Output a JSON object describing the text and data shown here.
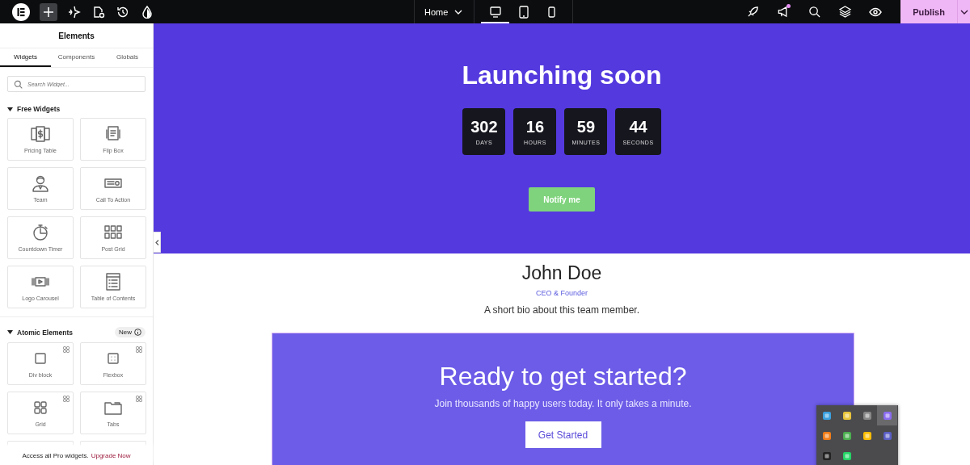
{
  "top_bar": {
    "page_selector": "Home",
    "devices": [
      {
        "kind": "desktop",
        "selected": true
      },
      {
        "kind": "tablet",
        "selected": false
      },
      {
        "kind": "mobile",
        "selected": false
      }
    ],
    "notification_dot": true,
    "publish": "Publish"
  },
  "sidebar": {
    "title": "Elements",
    "tabs": [
      {
        "label": "Widgets",
        "selected": true
      },
      {
        "label": "Components",
        "selected": false
      },
      {
        "label": "Globals",
        "selected": false
      }
    ],
    "search": {
      "placeholder": "Search Widget..."
    },
    "sections": [
      {
        "title": "Free Widgets",
        "expanded": true,
        "widgets": [
          {
            "label": "Pricing Table",
            "pro": false
          },
          {
            "label": "Flip Box",
            "pro": false
          },
          {
            "label": "Team",
            "pro": false
          },
          {
            "label": "Call To Action",
            "pro": false
          },
          {
            "label": "Countdown Timer",
            "pro": false
          },
          {
            "label": "Post Grid",
            "pro": false
          },
          {
            "label": "Logo Carousel",
            "pro": false
          },
          {
            "label": "Table of Contents",
            "pro": false
          }
        ]
      },
      {
        "title": "Atomic Elements",
        "expanded": true,
        "badge": "New",
        "widgets": [
          {
            "label": "Div block",
            "pro": true
          },
          {
            "label": "Flexbox",
            "pro": true
          },
          {
            "label": "Grid",
            "pro": true
          },
          {
            "label": "Tabs",
            "pro": true
          }
        ]
      }
    ],
    "footer": {
      "text": "Access all Pro widgets.",
      "link": "Upgrade Now"
    }
  },
  "canvas": {
    "hero": {
      "title": "Launching soon",
      "countdown": [
        {
          "value": "302",
          "unit": "DAYS"
        },
        {
          "value": "16",
          "unit": "HOURS"
        },
        {
          "value": "59",
          "unit": "MINUTES"
        },
        {
          "value": "44",
          "unit": "SECONDS"
        }
      ],
      "button": "Notify me"
    },
    "team": {
      "name": "John Doe",
      "role": "CEO & Founder",
      "bio": "A short bio about this team member."
    },
    "cta": {
      "title": "Ready to get started?",
      "text": "Join thousands of happy users today. It only takes a minute.",
      "button": "Get Started"
    }
  }
}
